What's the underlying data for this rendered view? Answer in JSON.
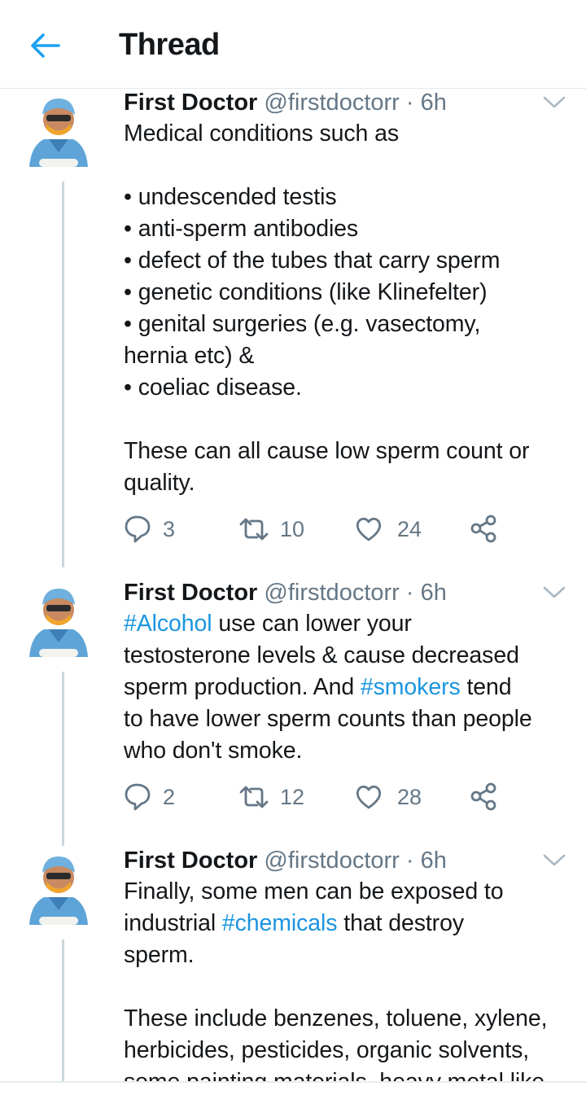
{
  "header": {
    "title": "Thread",
    "back_icon": "arrow-left-icon",
    "accent": "#1da1f2"
  },
  "tweets": [
    {
      "name": "First Doctor",
      "handle": "@firstdoctorr",
      "separator": "·",
      "time": "6h",
      "body_intro": "Medical conditions such as\n\n• undescended testis\n• anti-sperm antibodies\n• defect of the tubes that carry sperm\n• genetic conditions (like Klinefelter)\n• genital surgeries (e.g. vasectomy,\nhernia etc) &\n• coeliac disease.\n\nThese can all cause low sperm count or\nquality.",
      "replies": "3",
      "retweets": "10",
      "likes": "24"
    },
    {
      "name": "First Doctor",
      "handle": "@firstdoctorr",
      "separator": "·",
      "time": "6h",
      "hashtag1": "#Alcohol",
      "text1": " use can lower your\ntestosterone levels & cause decreased\nsperm production. And ",
      "hashtag2": "#smokers",
      "text2": " tend\nto have lower sperm counts than people\nwho don't smoke.",
      "replies": "2",
      "retweets": "12",
      "likes": "28"
    },
    {
      "name": "First Doctor",
      "handle": "@firstdoctorr",
      "separator": "·",
      "time": "6h",
      "text1": "Finally, some men can be exposed to\nindustrial ",
      "hashtag1": "#chemicals",
      "text2": " that destroy\nsperm.\n\nThese include benzenes, toluene, xylene,\nherbicides, pesticides, organic solvents,\nsome painting materials, heavy metal like"
    }
  ]
}
